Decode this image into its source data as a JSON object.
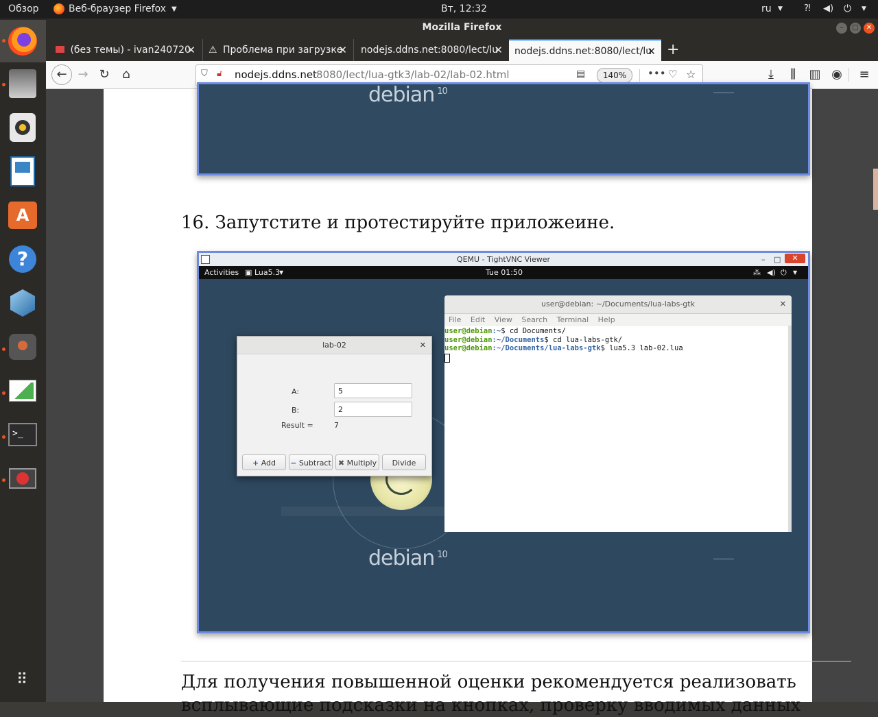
{
  "topbar": {
    "overview": "Обзор",
    "app_menu": "Веб-браузер Firefox",
    "clock": "Вт, 12:32",
    "lang": "ru"
  },
  "window": {
    "title": "Mozilla Firefox"
  },
  "tabs": [
    {
      "label": "(без темы) - ivan240720"
    },
    {
      "label": "Проблема при загрузке"
    },
    {
      "label": "nodejs.ddns.net:8080/lect/lu"
    },
    {
      "label": "nodejs.ddns.net:8080/lect/lu"
    }
  ],
  "navbar": {
    "url_host": "nodejs.ddns.net",
    "url_path": ":8080/lect/lua-gtk3/lab-02/lab-02.html",
    "zoom": "140%"
  },
  "page": {
    "step_text": "16. Запутстите и протестируйте приложеине.",
    "para_line1": "Для получения повышенной оценки рекомендуется реализовать",
    "para_line2": "всплывающие подсказки на кнопках, проверку вводимых данных"
  },
  "shot1": {
    "logo": "debian",
    "logo_ver": "10"
  },
  "vnc": {
    "title": "QEMU - TightVNC Viewer",
    "gnome_activities": "Activities",
    "gnome_app": "Lua5.3",
    "gnome_clock": "Tue 01:50",
    "logo": "debian",
    "logo_ver": "10",
    "terminal": {
      "title": "user@debian: ~/Documents/lua-labs-gtk",
      "menu": [
        "File",
        "Edit",
        "View",
        "Search",
        "Terminal",
        "Help"
      ],
      "lines": [
        {
          "user": "user@debian",
          "path": ":~",
          "cmd": "$ cd Documents/"
        },
        {
          "user": "user@debian",
          "path": ":~/Documents",
          "cmd": "$ cd lua-labs-gtk/"
        },
        {
          "user": "user@debian",
          "path": ":~/Documents/lua-labs-gtk",
          "cmd": "$ lua5.3 lab-02.lua"
        }
      ]
    },
    "dialog": {
      "title": "lab-02",
      "label_a": "A:",
      "value_a": "5",
      "label_b": "B:",
      "value_b": "2",
      "result_label": "Result =",
      "result_value": "7",
      "btn_add": "Add",
      "btn_sub": "Subtract",
      "btn_mul": "Multiply",
      "btn_div": "Divide"
    }
  },
  "colors": {
    "accent": "#0a84ff",
    "dock_indicator": "#e95420"
  }
}
